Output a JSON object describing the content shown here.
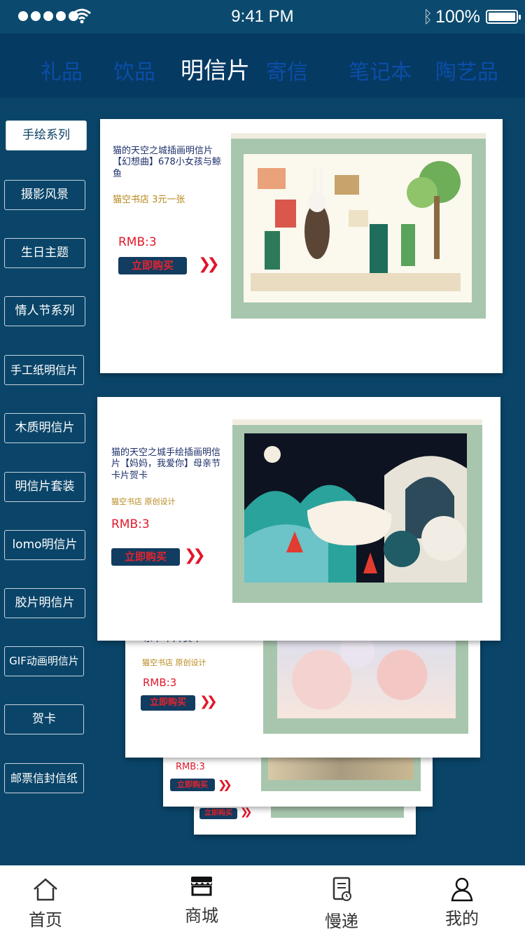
{
  "status_bar": {
    "time": "9:41 PM",
    "battery": "100%"
  },
  "tabs": [
    {
      "label": "礼品"
    },
    {
      "label": "饮品"
    },
    {
      "label": "明信片",
      "active": true
    },
    {
      "label": "寄信"
    },
    {
      "label": "笔记本"
    },
    {
      "label": "陶艺品"
    }
  ],
  "sidebar": [
    {
      "label": "手绘系列",
      "active": true
    },
    {
      "label": "摄影风景"
    },
    {
      "label": "生日主题"
    },
    {
      "label": "情人节系列"
    },
    {
      "label": "手工纸明信片"
    },
    {
      "label": "木质明信片"
    },
    {
      "label": "明信片套装"
    },
    {
      "label": "lomo明信片"
    },
    {
      "label": "胶片明信片"
    },
    {
      "label": "GIF动画明信片"
    },
    {
      "label": "贺卡"
    },
    {
      "label": "邮票信封信纸"
    }
  ],
  "products": [
    {
      "title": "猫的天空之城插画明信片【幻想曲】678小女孩与鲸鱼",
      "shop": "猫空书店 3元一张",
      "price": "RMB:3",
      "buy_label": "立即购买"
    },
    {
      "title": "猫的天空之城手绘插画明信片【妈妈，我爱你】母亲节卡片贺卡",
      "shop": "猫空书店 原创设计",
      "price": "RMB:3",
      "buy_label": "立即购买"
    },
    {
      "title": "亲节卡片贺卡",
      "shop": "猫空书店 原创设计",
      "price": "RMB:3",
      "buy_label": "立即购买"
    },
    {
      "price": "RMB:3",
      "buy_label": "立即购买"
    },
    {
      "buy_label": "立即购买"
    }
  ],
  "bottom_nav": [
    {
      "label": "首页",
      "icon": "home-icon"
    },
    {
      "label": "商城",
      "icon": "shop-icon",
      "active": true
    },
    {
      "label": "慢递",
      "icon": "slow-mail-icon"
    },
    {
      "label": "我的",
      "icon": "user-icon"
    }
  ],
  "colors": {
    "background": "#0a4569",
    "header": "#053a63",
    "price": "#e1192b",
    "shop": "#b7871b",
    "buy_button": "#123c60"
  }
}
